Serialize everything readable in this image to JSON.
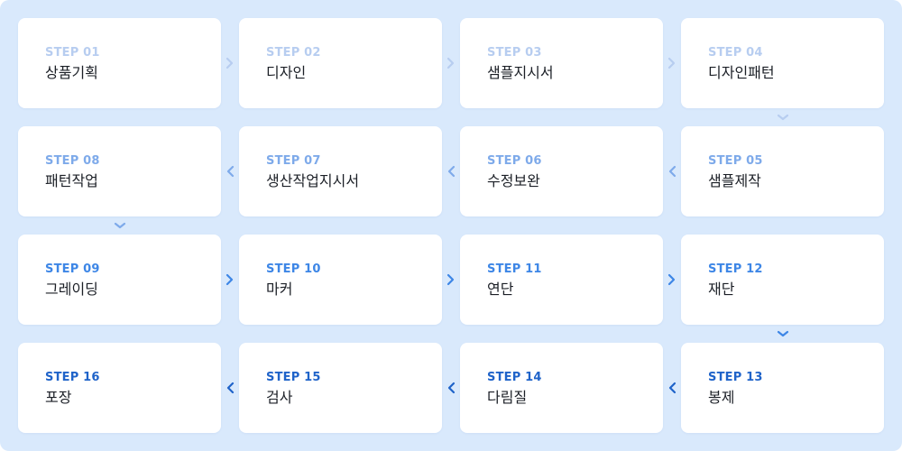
{
  "colors": {
    "board_bg": "#d9e9fc",
    "card_bg": "#ffffff",
    "title_text": "#1b1f26",
    "row_accents": [
      "#b7cdf0",
      "#7eaaea",
      "#3d86e6",
      "#1f63c9"
    ]
  },
  "steps": [
    {
      "label": "STEP 01",
      "name": "상품기획"
    },
    {
      "label": "STEP 02",
      "name": "디자인"
    },
    {
      "label": "STEP 03",
      "name": "샘플지시서"
    },
    {
      "label": "STEP 04",
      "name": "디자인패턴"
    },
    {
      "label": "STEP 05",
      "name": "샘플제작"
    },
    {
      "label": "STEP 06",
      "name": "수정보완"
    },
    {
      "label": "STEP 07",
      "name": "생산작업지시서"
    },
    {
      "label": "STEP 08",
      "name": "패턴작업"
    },
    {
      "label": "STEP 09",
      "name": "그레이딩"
    },
    {
      "label": "STEP 10",
      "name": "마커"
    },
    {
      "label": "STEP 11",
      "name": "연단"
    },
    {
      "label": "STEP 12",
      "name": "재단"
    },
    {
      "label": "STEP 13",
      "name": "봉제"
    },
    {
      "label": "STEP 14",
      "name": "다림질"
    },
    {
      "label": "STEP 15",
      "name": "검사"
    },
    {
      "label": "STEP 16",
      "name": "포장"
    }
  ],
  "arrows": [
    {
      "icon": "chevron-right-icon"
    },
    {
      "icon": "chevron-down-icon"
    },
    {
      "icon": "chevron-left-icon"
    }
  ]
}
